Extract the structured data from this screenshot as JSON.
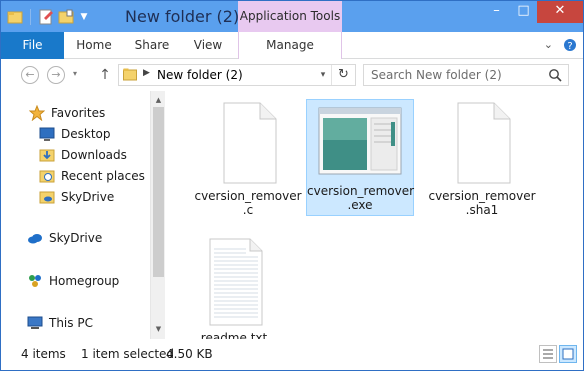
{
  "window": {
    "title": "New folder (2)",
    "context_tab": "Application Tools",
    "buttons": {
      "minimize": "–",
      "maximize": "□",
      "close": "✕"
    }
  },
  "ribbon": {
    "tabs": [
      "File",
      "Home",
      "Share",
      "View",
      "Manage"
    ],
    "right_icons": [
      "chevron-down-icon",
      "help-icon"
    ]
  },
  "navbar": {
    "back": "←",
    "forward": "→",
    "up": "↑",
    "path": "New folder (2)",
    "search_placeholder": "Search New folder (2)"
  },
  "sidebar": {
    "items": [
      {
        "label": "Favorites",
        "icon": "star-icon"
      },
      {
        "label": "Desktop",
        "icon": "desktop-icon"
      },
      {
        "label": "Downloads",
        "icon": "downloads-icon"
      },
      {
        "label": "Recent places",
        "icon": "recent-places-icon"
      },
      {
        "label": "SkyDrive",
        "icon": "skydrive-folder-icon"
      },
      {
        "label": "SkyDrive",
        "icon": "skydrive-cloud-icon"
      },
      {
        "label": "Homegroup",
        "icon": "homegroup-icon"
      },
      {
        "label": "This PC",
        "icon": "this-pc-icon"
      }
    ]
  },
  "files": [
    {
      "name_line1": "cversion_remover",
      "name_line2": ".c",
      "icon": "blank-document-icon"
    },
    {
      "name_line1": "cversion_remover",
      "name_line2": ".exe",
      "icon": "application-icon"
    },
    {
      "name_line1": "cversion_remover",
      "name_line2": ".sha1",
      "icon": "blank-document-icon"
    },
    {
      "name_line1": "readme.txt",
      "name_line2": "",
      "icon": "text-document-icon"
    }
  ],
  "status": {
    "items": "4 items",
    "selected": "1 item selected",
    "size": "4.50 KB"
  },
  "colors": {
    "titlebar": "#5aa0ee",
    "file_tab": "#1979ca",
    "context_tab": "#e8c9f0",
    "close_button": "#c7463e",
    "selection": "#cce8ff"
  }
}
